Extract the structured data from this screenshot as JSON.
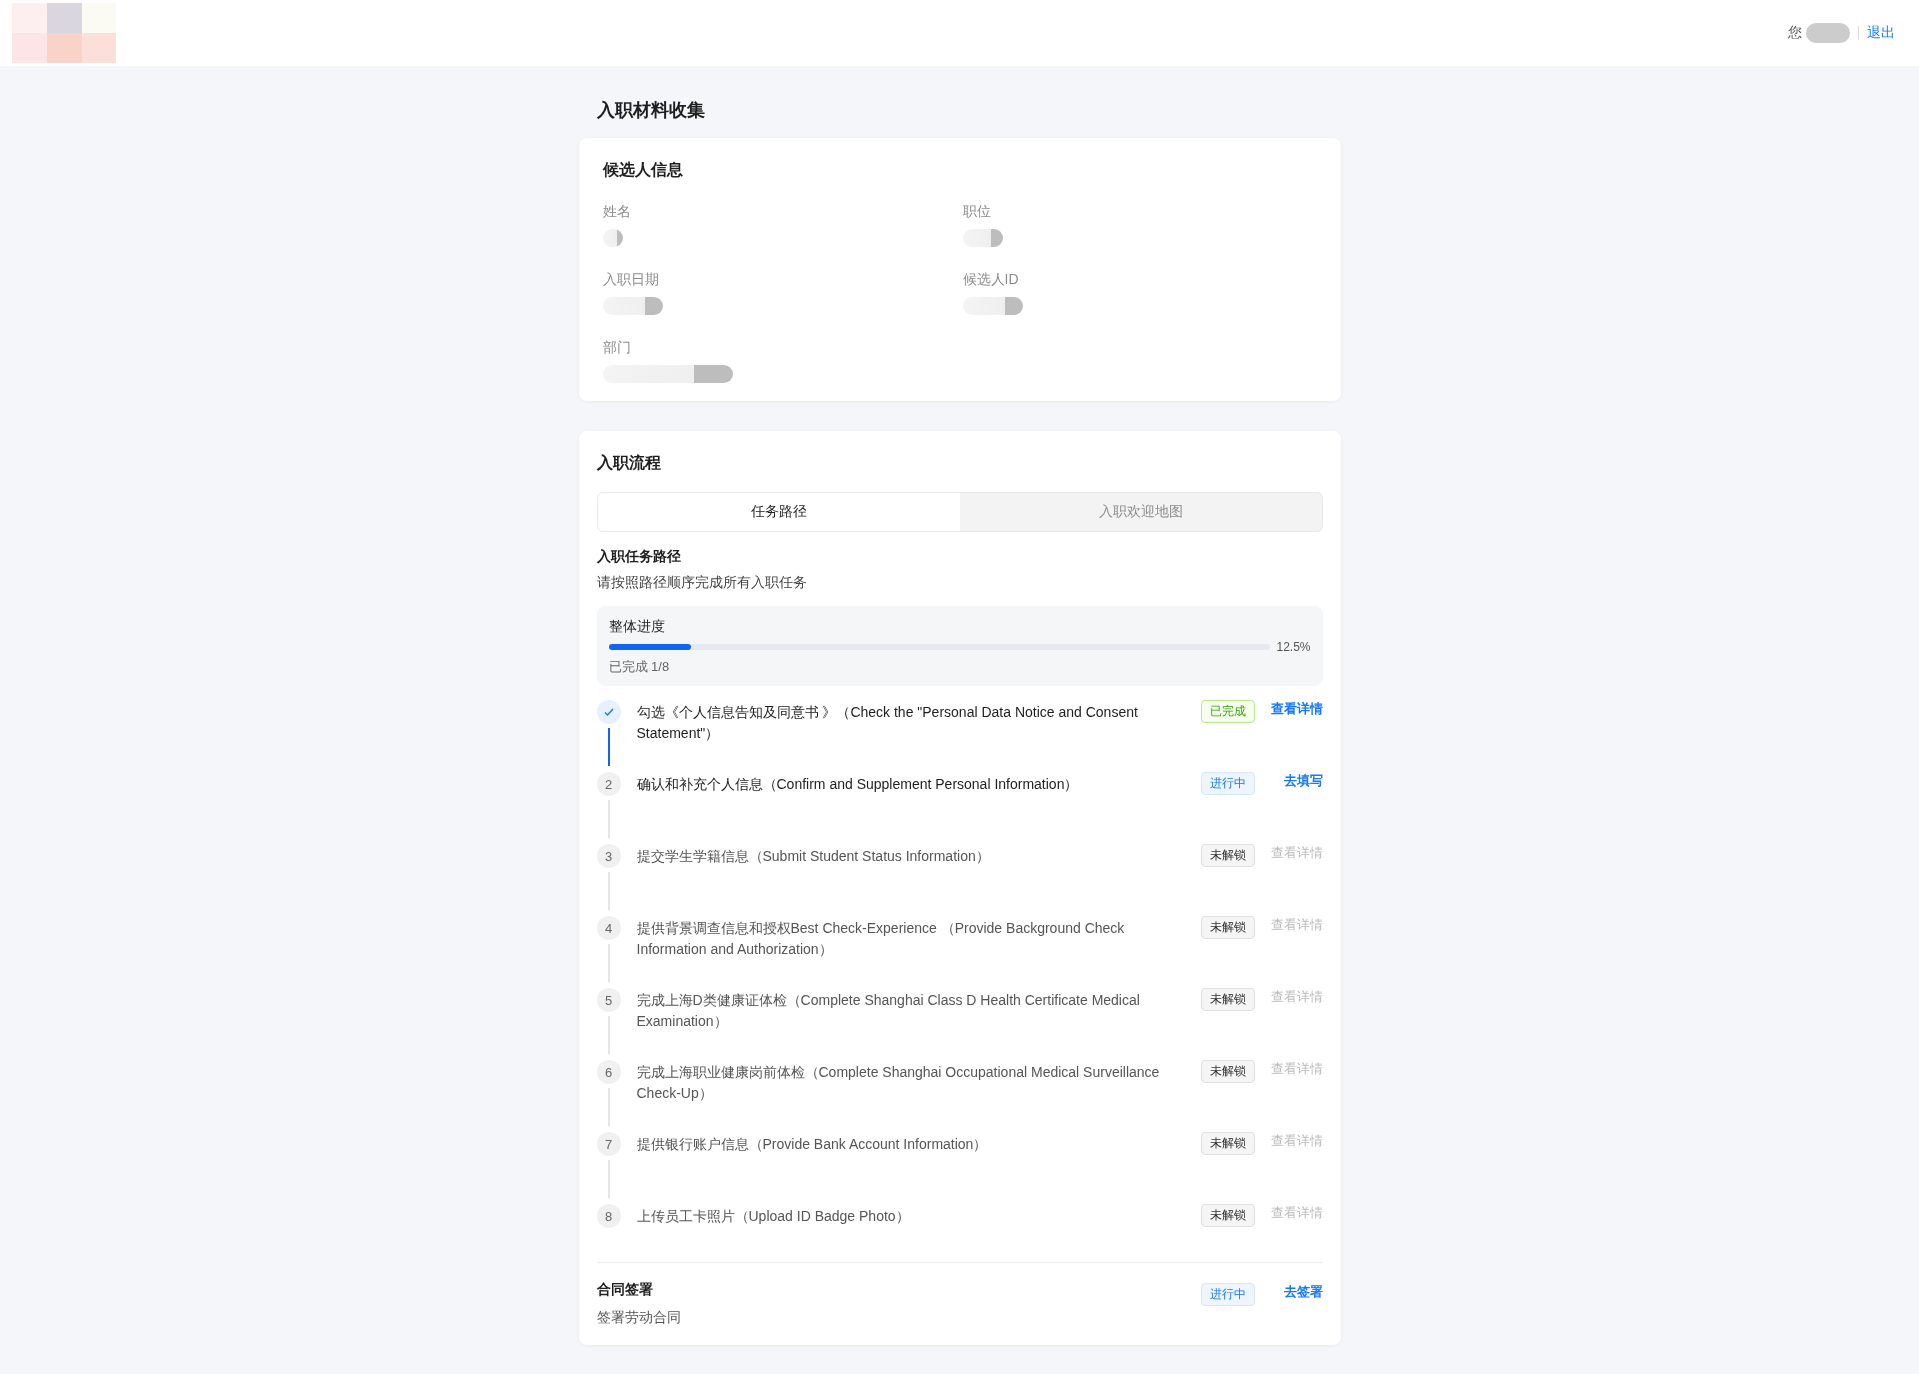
{
  "header": {
    "greeting": "您",
    "logout": "退出"
  },
  "page_title": "入职材料收集",
  "candidate_card": {
    "title": "候选人信息",
    "fields": [
      {
        "label": "姓名"
      },
      {
        "label": "职位"
      },
      {
        "label": "入职日期"
      },
      {
        "label": "候选人ID"
      },
      {
        "label": "部门"
      }
    ]
  },
  "flow_card": {
    "title": "入职流程",
    "tabs": [
      {
        "label": "任务路径",
        "selected": true
      },
      {
        "label": "入职欢迎地图",
        "selected": false
      }
    ],
    "section_title": "入职任务路径",
    "section_subtitle": "请按照路径顺序完成所有入职任务",
    "progress": {
      "label": "整体进度",
      "level": 0.125,
      "percent": "12.5%",
      "completed": "已完成 1/8"
    },
    "steps": [
      {
        "kind": "done",
        "text": "勾选《个人信息告知及同意书 》（Check the \"Personal Data Notice and Consent Statement\"）",
        "tag": "已完成",
        "action": "查看详情"
      },
      {
        "kind": "active",
        "number": "2",
        "text": "确认和补充个人信息（Confirm and Supplement Personal Information）",
        "tag": "进行中",
        "action": "去填写"
      },
      {
        "kind": "locked",
        "number": "3",
        "text": "提交学生学籍信息（Submit Student Status Information）",
        "tag": "未解锁",
        "action": "查看详情"
      },
      {
        "kind": "locked",
        "number": "4",
        "text": "提供背景调查信息和授权Best Check-Experience （Provide Background Check Information and Authorization）",
        "tag": "未解锁",
        "action": "查看详情"
      },
      {
        "kind": "locked",
        "number": "5",
        "text": "完成上海D类健康证体检（Complete Shanghai Class D Health Certificate Medical Examination）",
        "tag": "未解锁",
        "action": "查看详情"
      },
      {
        "kind": "locked",
        "number": "6",
        "text": "完成上海职业健康岗前体检（Complete Shanghai Occupational Medical Surveillance Check-Up）",
        "tag": "未解锁",
        "action": "查看详情"
      },
      {
        "kind": "locked",
        "number": "7",
        "text": "提供银行账户信息（Provide Bank Account Information）",
        "tag": "未解锁",
        "action": "查看详情"
      },
      {
        "kind": "locked",
        "number": "8",
        "text": "上传员工卡照片（Upload ID Badge Photo）",
        "tag": "未解锁",
        "action": "查看详情"
      }
    ],
    "contract": {
      "kind": "active",
      "title": "合同签署",
      "subtitle": "签署劳动合同",
      "tag": "进行中",
      "action": "去签署"
    }
  }
}
